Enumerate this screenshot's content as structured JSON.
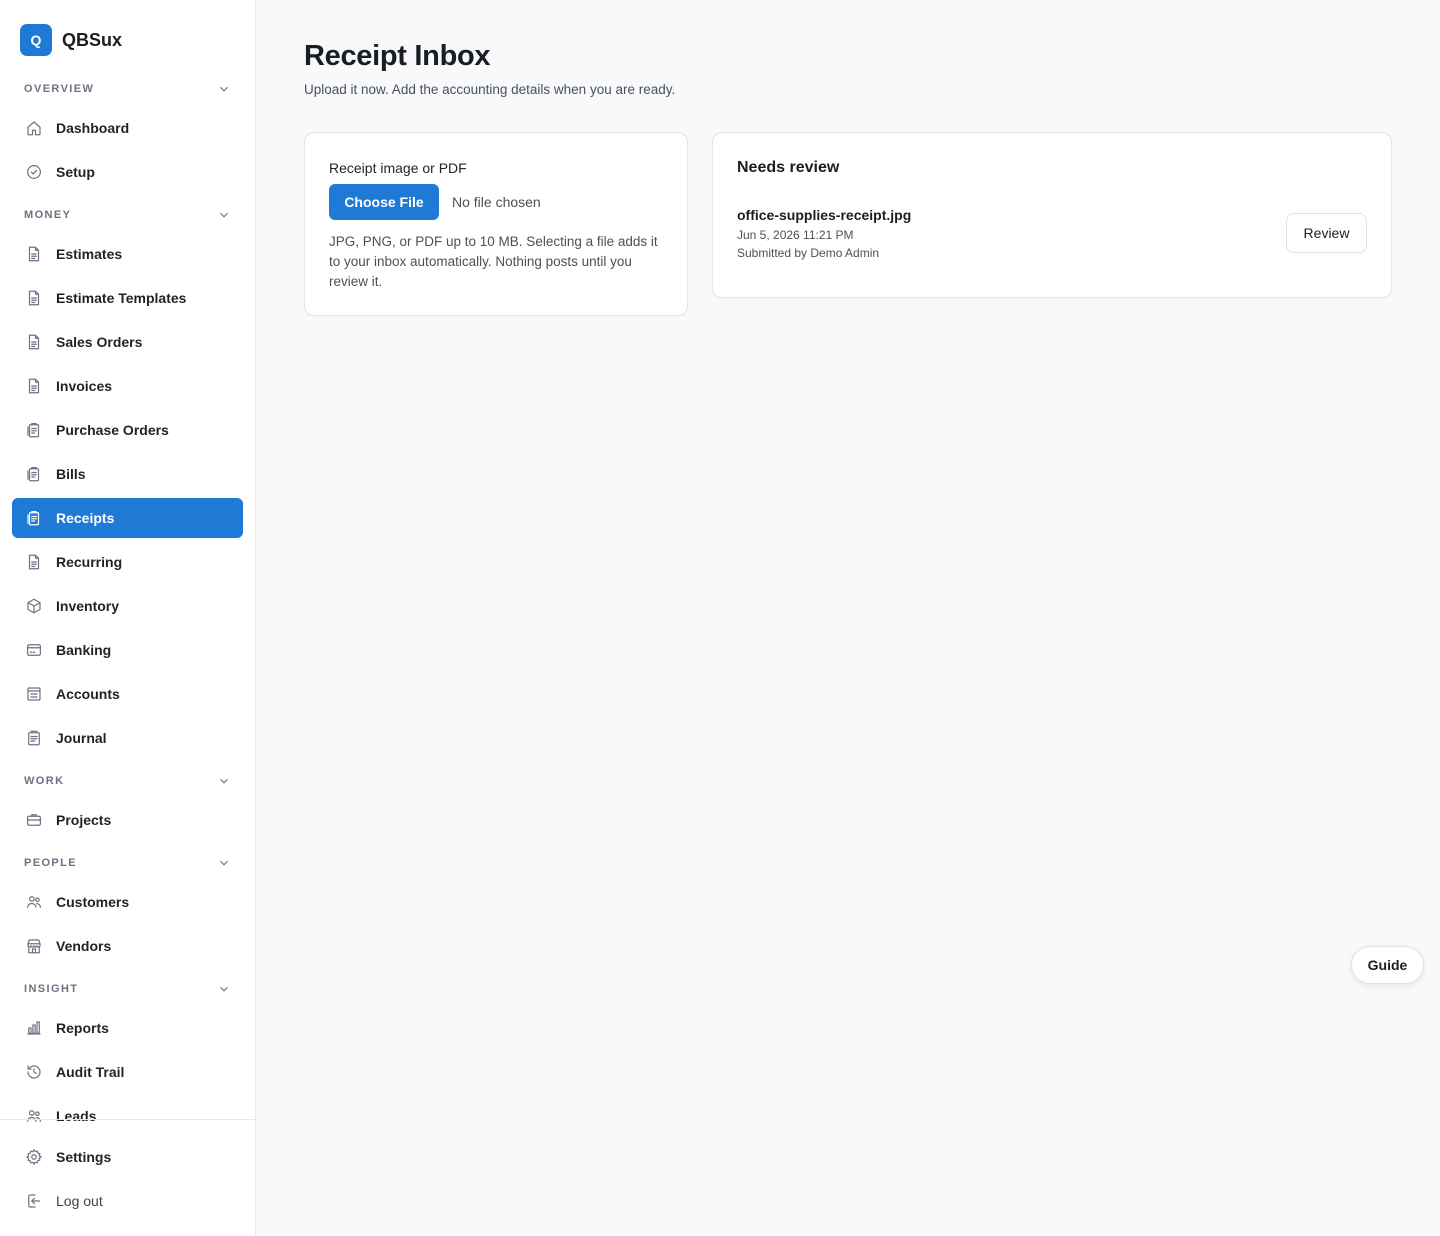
{
  "app": {
    "name": "QBSux",
    "logo_letter": "Q"
  },
  "colors": {
    "accent": "#1f7ad6",
    "sidebar_bg": "#ffffff",
    "page_bg": "#f8f9fa"
  },
  "sidebar": {
    "sections": [
      {
        "label": "OVERVIEW",
        "items": [
          {
            "label": "Dashboard",
            "icon": "home-icon"
          },
          {
            "label": "Setup",
            "icon": "check-circle-icon"
          }
        ]
      },
      {
        "label": "MONEY",
        "items": [
          {
            "label": "Estimates",
            "icon": "document-icon"
          },
          {
            "label": "Estimate Templates",
            "icon": "document-icon"
          },
          {
            "label": "Sales Orders",
            "icon": "document-icon"
          },
          {
            "label": "Invoices",
            "icon": "document-icon"
          },
          {
            "label": "Purchase Orders",
            "icon": "clipboard-icon"
          },
          {
            "label": "Bills",
            "icon": "clipboard-icon"
          },
          {
            "label": "Receipts",
            "icon": "clipboard-icon",
            "active": true
          },
          {
            "label": "Recurring",
            "icon": "document-icon"
          },
          {
            "label": "Inventory",
            "icon": "box-icon"
          },
          {
            "label": "Banking",
            "icon": "bank-card-icon"
          },
          {
            "label": "Accounts",
            "icon": "ledger-icon"
          },
          {
            "label": "Journal",
            "icon": "journal-icon"
          }
        ]
      },
      {
        "label": "WORK",
        "items": [
          {
            "label": "Projects",
            "icon": "briefcase-icon"
          }
        ]
      },
      {
        "label": "PEOPLE",
        "items": [
          {
            "label": "Customers",
            "icon": "users-icon"
          },
          {
            "label": "Vendors",
            "icon": "store-icon"
          }
        ]
      },
      {
        "label": "INSIGHT",
        "items": [
          {
            "label": "Reports",
            "icon": "bar-chart-icon"
          },
          {
            "label": "Audit Trail",
            "icon": "history-icon"
          },
          {
            "label": "Leads",
            "icon": "users-icon"
          }
        ]
      }
    ],
    "footer": {
      "settings_label": "Settings",
      "logout_label": "Log out"
    }
  },
  "page": {
    "title": "Receipt Inbox",
    "subtitle": "Upload it now. Add the accounting details when you are ready."
  },
  "upload": {
    "field_label": "Receipt image or PDF",
    "choose_label": "Choose File",
    "no_file_text": "No file chosen",
    "help_text": "JPG, PNG, or PDF up to 10 MB. Selecting a file adds it to your inbox automatically. Nothing posts until you review it."
  },
  "review": {
    "title": "Needs review",
    "items": [
      {
        "file_name": "office-supplies-receipt.jpg",
        "date": "Jun 5, 2026 11:21 PM",
        "submitted_by": "Submitted by Demo Admin",
        "action_label": "Review"
      }
    ]
  },
  "guide_label": "Guide"
}
